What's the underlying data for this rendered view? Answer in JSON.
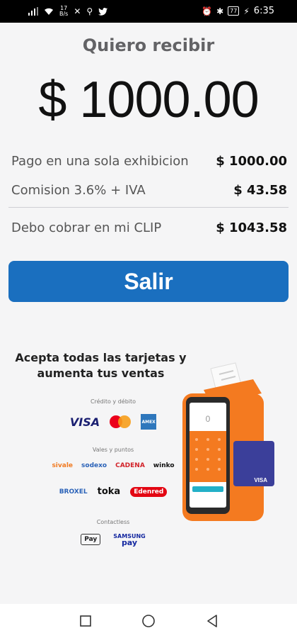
{
  "status_bar": {
    "time": "6:35",
    "battery": "77",
    "data_speed_top": "17",
    "data_speed_bottom": "B/s"
  },
  "title": "Quiero recibir",
  "amount": "$ 1000.00",
  "summary": {
    "rows": [
      {
        "label": "Pago en una sola exhibicion",
        "value": "$ 1000.00"
      },
      {
        "label": "Comision 3.6% + IVA",
        "value": "$ 43.58"
      },
      {
        "label": "Debo cobrar en mi CLIP",
        "value": "$ 1043.58"
      }
    ]
  },
  "exit_button": {
    "label": "Salir",
    "color": "#1a6fbf"
  },
  "promo": {
    "headline_line1": "Acepta todas las tarjetas y",
    "headline_line2": "aumenta tus ventas",
    "credit_debit_label": "Crédito y débito",
    "vouchers_label": "Vales y puntos",
    "contactless_label": "Contactless",
    "card_logos": {
      "visa": "VISA",
      "amex": "AMEX"
    },
    "voucher_logos": {
      "sivale": "sivale",
      "sodexo": "sodexo",
      "cadeco": "CADENA",
      "winko": "winko",
      "broxel": "BROXEL",
      "toka": "toka",
      "edenred": "Edenred"
    },
    "contactless_logos": {
      "apple_pay": "Pay",
      "samsung_line1": "SAMSUNG",
      "samsung_line2": "pay"
    },
    "card_visa": "VISA",
    "device_amount": "0"
  }
}
